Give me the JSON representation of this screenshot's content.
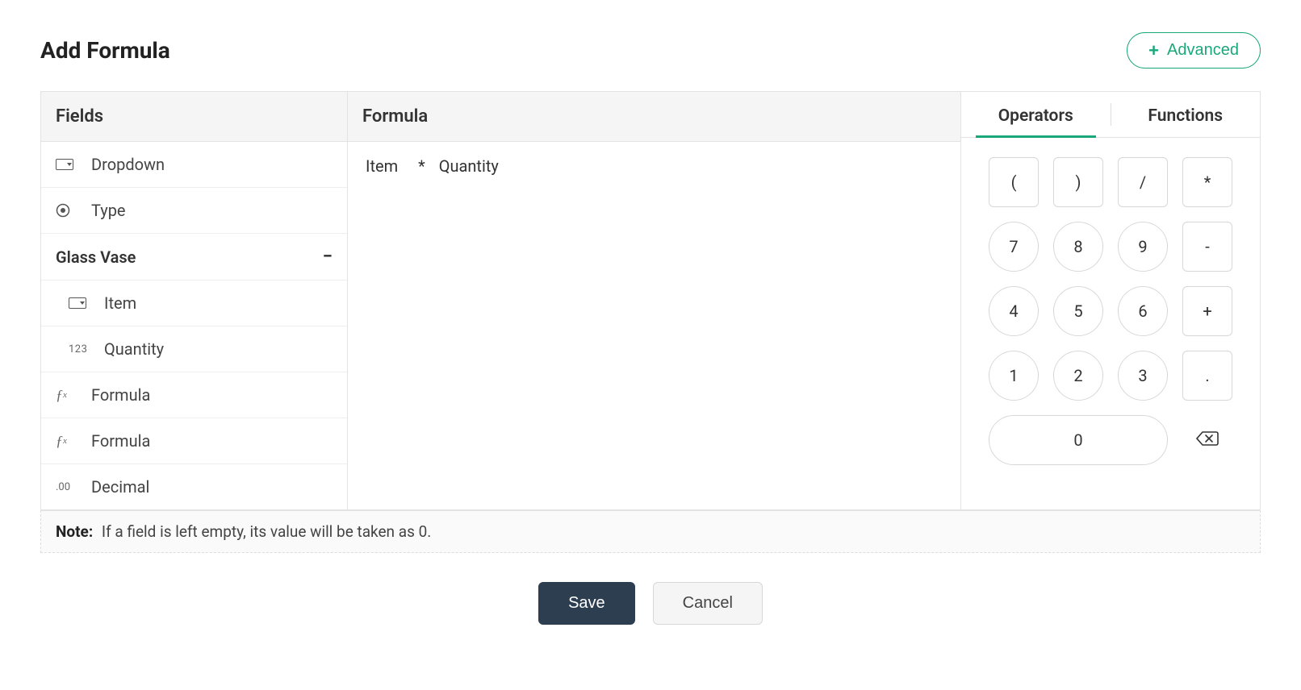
{
  "header": {
    "title": "Add Formula",
    "advanced_label": "Advanced"
  },
  "columns": {
    "fields_header": "Fields",
    "formula_header": "Formula"
  },
  "fields": {
    "dropdown": "Dropdown",
    "type": "Type",
    "group_name": "Glass Vase",
    "item": "Item",
    "quantity": "Quantity",
    "formula1": "Formula",
    "formula2": "Formula",
    "decimal": "Decimal"
  },
  "formula": {
    "token1": "Item",
    "op": "*",
    "token2": "Quantity"
  },
  "tabs": {
    "operators": "Operators",
    "functions": "Functions"
  },
  "keys": {
    "lparen": "(",
    "rparen": ")",
    "slash": "/",
    "star": "*",
    "k7": "7",
    "k8": "8",
    "k9": "9",
    "minus": "-",
    "k4": "4",
    "k5": "5",
    "k6": "6",
    "plus": "+",
    "k1": "1",
    "k2": "2",
    "k3": "3",
    "dot": ".",
    "k0": "0"
  },
  "note": {
    "label": "Note:",
    "text": "If a field is left empty, its value will be taken as 0."
  },
  "footer": {
    "save": "Save",
    "cancel": "Cancel"
  }
}
